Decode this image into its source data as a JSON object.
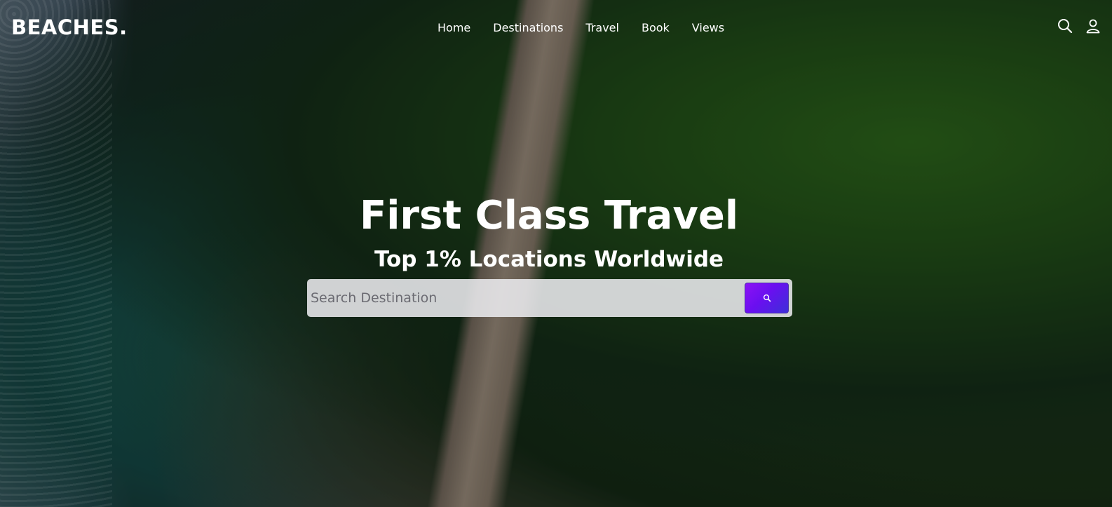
{
  "header": {
    "logo": "BEACHES.",
    "nav": [
      "Home",
      "Destinations",
      "Travel",
      "Book",
      "Views"
    ],
    "icons": [
      "search-icon",
      "user-icon"
    ]
  },
  "hero": {
    "title": "First Class Travel",
    "subtitle": "Top 1% Locations Worldwide"
  },
  "search": {
    "placeholder": "Search Destination",
    "value": "",
    "button_icon": "search-icon"
  },
  "colors": {
    "text": "#ffffff",
    "search_button": "#7a10f2",
    "search_bar_bg": "#ebebee"
  }
}
